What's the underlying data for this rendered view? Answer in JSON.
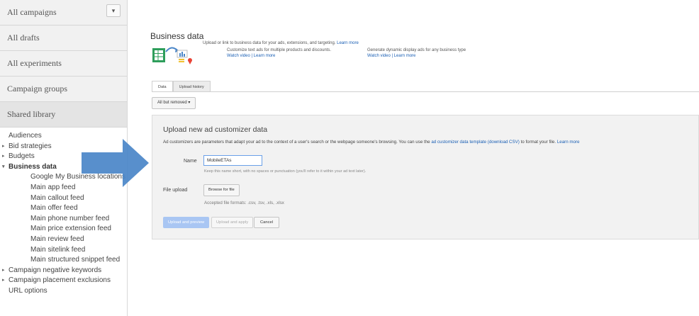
{
  "sidebar": {
    "all_campaigns": "All campaigns",
    "campaigns_dropdown_glyph": "▾",
    "all_drafts": "All drafts",
    "all_experiments": "All experiments",
    "campaign_groups": "Campaign groups",
    "shared_library": "Shared library",
    "shared_items": {
      "audiences": "Audiences",
      "bid_strategies": "Bid strategies",
      "budgets": "Budgets",
      "business_data": "Business data",
      "gmb_locations": "Google My Business locations",
      "main_app_feed": "Main app feed",
      "main_callout_feed": "Main callout feed",
      "main_offer_feed": "Main offer feed",
      "main_phone_number_feed": "Main phone number feed",
      "main_price_extension_feed": "Main price extension feed",
      "main_review_feed": "Main review feed",
      "main_sitelink_feed": "Main sitelink feed",
      "main_structured_snippet_feed": "Main structured snippet feed",
      "campaign_negative_keywords": "Campaign negative keywords",
      "campaign_placement_exclusions": "Campaign placement exclusions",
      "url_options": "URL options"
    }
  },
  "main": {
    "title": "Business data",
    "intro_text": "Upload or link to business data for your ads, extensions, and targeting.",
    "intro_learn_more": "Learn more",
    "col1_text": "Customize text ads for multiple products and discounts.",
    "col1_links": "Watch video | Learn more",
    "col2_text": "Generate dynamic display ads for any business type",
    "col2_links": "Watch video | Learn more",
    "tabs": {
      "data": "Data",
      "upload_history": "Upload history"
    },
    "filter_label": "All but removed ▾",
    "panel": {
      "title": "Upload new ad customizer data",
      "desc_prefix": "Ad customizers are parameters that adapt your ad to the context of a user's search or the webpage someone's browsing. You can use the",
      "desc_link": "ad customizer data template (download CSV)",
      "desc_suffix": "to format your file.",
      "desc_learn": "Learn more",
      "name_label": "Name",
      "name_value": "MobileETAs",
      "name_hint": "Keep this name short, with no spaces or punctuation (you'll refer to it within your ad text later).",
      "file_upload_label": "File upload",
      "browse_label": "Browse for file",
      "formats": "Accepted file formats: .csv, .tsv, .xls, .xlsx",
      "upload_preview": "Upload and preview",
      "upload_apply": "Upload and apply",
      "cancel": "Cancel"
    }
  },
  "colors": {
    "arrow": "#4a86c8",
    "link": "#1a5fb4",
    "primary_button": "#a9c6f3"
  }
}
